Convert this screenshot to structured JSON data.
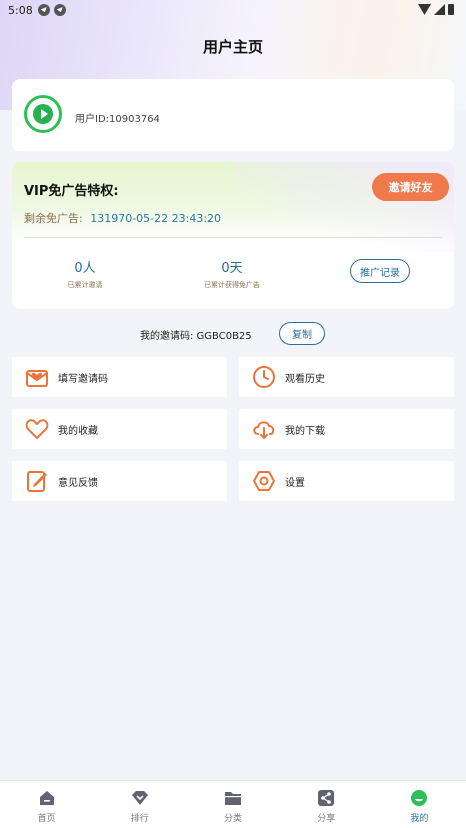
{
  "status_bar": {
    "time": "5:08"
  },
  "page_title": "用户主页",
  "user": {
    "id_label": "用户ID:10903764"
  },
  "vip": {
    "title": "VIP免广告特权:",
    "invite_button": "邀请好友",
    "remain_label": "剩余免广告:",
    "remain_value": "131970-05-22 23:43:20",
    "invited_count": "0人",
    "invited_label": "已累计邀请",
    "earned_days": "0天",
    "earned_label": "已累计获得免广告",
    "record_button": "推广记录"
  },
  "invite_code": {
    "text": "我的邀请码: GGBC0B25",
    "copy_button": "复制"
  },
  "menu": [
    {
      "label": "填写邀请码",
      "icon": "mail-heart-icon"
    },
    {
      "label": "观看历史",
      "icon": "clock-icon"
    },
    {
      "label": "我的收藏",
      "icon": "heart-icon"
    },
    {
      "label": "我的下载",
      "icon": "cloud-download-icon"
    },
    {
      "label": "意见反馈",
      "icon": "edit-note-icon"
    },
    {
      "label": "设置",
      "icon": "hexagon-settings-icon"
    }
  ],
  "nav": [
    {
      "label": "首页",
      "icon": "home-icon"
    },
    {
      "label": "排行",
      "icon": "diamond-icon"
    },
    {
      "label": "分类",
      "icon": "folder-icon"
    },
    {
      "label": "分享",
      "icon": "share-icon"
    },
    {
      "label": "我的",
      "icon": "profile-icon",
      "active": true
    }
  ],
  "colors": {
    "accent": "#f07a4c",
    "link": "#2a6e9e",
    "icon_orange": "#e8753a",
    "active_green": "#2fbf59"
  }
}
